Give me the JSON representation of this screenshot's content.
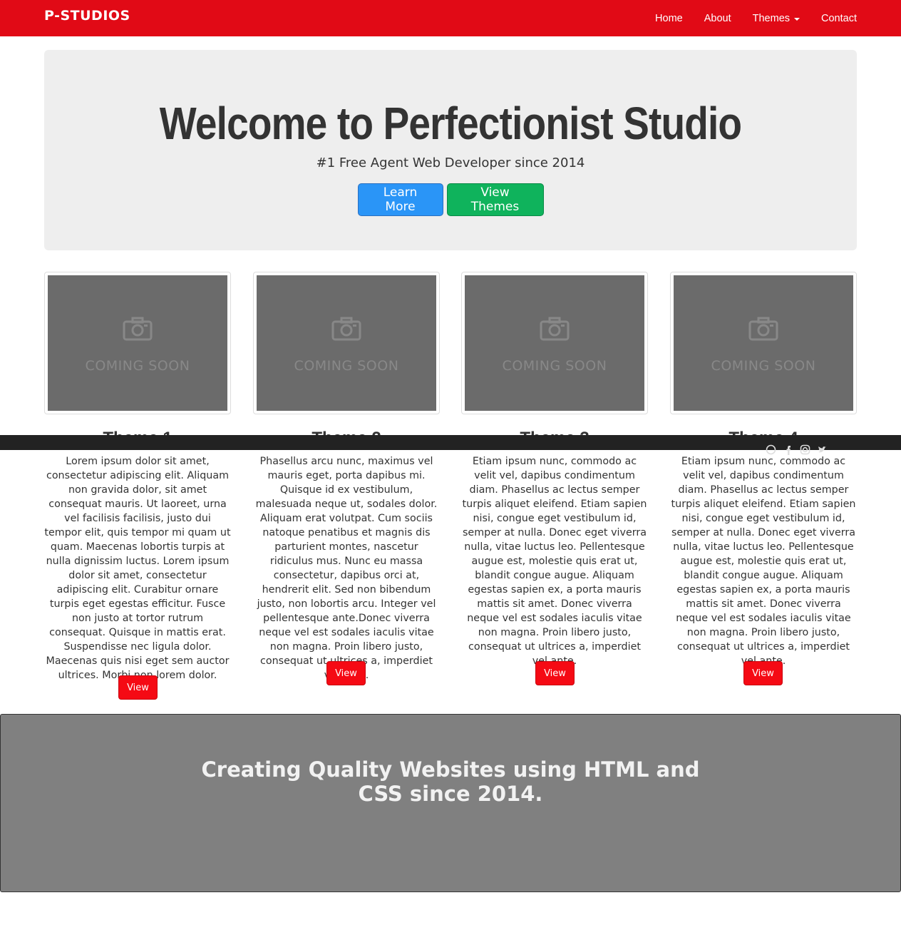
{
  "navbar": {
    "brand": "P-STUDIOS",
    "links": [
      {
        "label": "Home"
      },
      {
        "label": "About"
      },
      {
        "label": "Themes"
      },
      {
        "label": "Contact"
      }
    ],
    "color": "#e10a16"
  },
  "hero": {
    "title": "Welcome to Perfectionist Studio",
    "subtitle": "#1 Free Agent Web Developer since 2014",
    "learn_more": "Learn More",
    "view_themes": "View Themes"
  },
  "cards": [
    {
      "placeholder": "COMING SOON",
      "title": "Theme 1",
      "text": "Lorem ipsum dolor sit amet, consectetur adipiscing elit. Aliquam non gravida dolor, sit amet consequat mauris. Ut laoreet, urna vel facilisis facilisis, justo dui tempor elit, quis tempor mi quam ut quam. Maecenas lobortis turpis at nulla dignissim luctus. Lorem ipsum dolor sit amet, consectetur adipiscing elit. Curabitur ornare turpis eget egestas efficitur. Fusce non justo at tortor rutrum consequat. Quisque in mattis erat. Suspendisse nec ligula dolor. Maecenas quis nisi eget sem auctor ultrices. Morbi non lorem dolor.",
      "button": "View"
    },
    {
      "placeholder": "COMING SOON",
      "title": "Theme 2",
      "text": "Phasellus arcu nunc, maximus vel mauris eget, porta dapibus mi. Quisque id ex vestibulum, malesuada neque ut, sodales dolor. Aliquam erat volutpat. Cum sociis natoque penatibus et magnis dis parturient montes, nascetur ridiculus mus. Nunc eu massa consectetur, dapibus orci at, hendrerit elit. Sed non bibendum justo, non lobortis arcu. Integer vel pellentesque ante.Donec viverra neque vel est sodales iaculis vitae non magna. Proin libero justo, consequat ut ultrices a, imperdiet vel ante.",
      "button": "View"
    },
    {
      "placeholder": "COMING SOON",
      "title": "Theme 3",
      "text": "Etiam ipsum nunc, commodo ac velit vel, dapibus condimentum diam. Phasellus ac lectus semper turpis aliquet eleifend. Etiam sapien nisi, congue eget vestibulum id, semper at nulla. Donec eget viverra nulla, vitae luctus leo. Pellentesque augue est, molestie quis erat ut, blandit congue augue. Aliquam egestas sapien ex, a porta mauris mattis sit amet. Donec viverra neque vel est sodales iaculis vitae non magna. Proin libero justo, consequat ut ultrices a, imperdiet vel ante.",
      "button": "View"
    },
    {
      "placeholder": "COMING SOON",
      "title": "Theme 4",
      "text": "Etiam ipsum nunc, commodo ac velit vel, dapibus condimentum diam. Phasellus ac lectus semper turpis aliquet eleifend. Etiam sapien nisi, congue eget vestibulum id, semper at nulla. Donec eget viverra nulla, vitae luctus leo. Pellentesque augue est, molestie quis erat ut, blandit congue augue. Aliquam egestas sapien ex, a porta mauris mattis sit amet. Donec viverra neque vel est sodales iaculis vitae non magna. Proin libero justo, consequat ut ultrices a, imperdiet vel ante.",
      "button": "View"
    }
  ],
  "footer": {
    "social_icons": [
      "globe-icon",
      "facebook-icon",
      "instagram-icon",
      "twitter-icon"
    ]
  },
  "banner": {
    "text": "Creating Quality Websites using HTML and CSS since 2014."
  }
}
